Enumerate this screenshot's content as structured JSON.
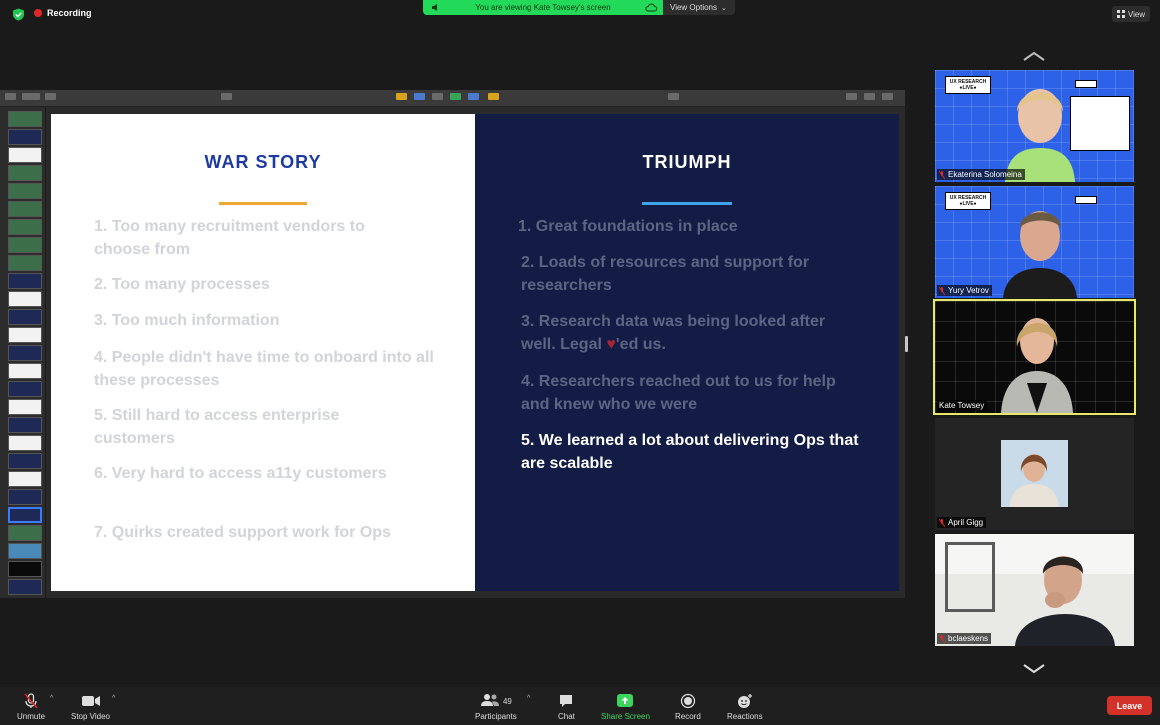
{
  "top": {
    "recording_label": "Recording",
    "viewing_text": "You are viewing Kate Towsey's screen",
    "view_options_label": "View Options",
    "view_label": "View"
  },
  "slide": {
    "left_title": "WAR STORY",
    "right_title": "TRIUMPH",
    "left_items": [
      "1. Too many recruitment vendors to choose from",
      "2. Too many processes",
      "3. Too much information",
      "4. People didn't have time to onboard into all these processes",
      "5. Still hard to access enterprise customers",
      "6. Very hard to access a11y customers",
      "7. Quirks created support work for Ops"
    ],
    "right_items": {
      "r1": "1. Great foundations in place",
      "r2": "2. Loads of resources and support for researchers",
      "r3a": "3. Research data was being looked after well. Legal ",
      "r3heart": "♥",
      "r3b": "'ed us.",
      "r4": "4. Researchers reached out to us for help and knew who we were",
      "r5": "5. We learned a lot about delivering Ops that are scalable"
    },
    "colors": {
      "left_title": "#1c3aa0",
      "right_bg": "#121c45",
      "orange": "#f0a834",
      "blue": "#3fa3e8"
    }
  },
  "participants": [
    {
      "name": "Ekaterina Solomeina"
    },
    {
      "name": "Yury Vetrov"
    },
    {
      "name": "Kate Towsey"
    },
    {
      "name": "April Gigg"
    },
    {
      "name": "bclaeskens"
    }
  ],
  "toolbar": {
    "unmute": "Unmute",
    "stop_video": "Stop Video",
    "participants": "Participants",
    "participant_count": "49",
    "chat": "Chat",
    "share_screen": "Share Screen",
    "record": "Record",
    "reactions": "Reactions",
    "leave": "Leave"
  }
}
